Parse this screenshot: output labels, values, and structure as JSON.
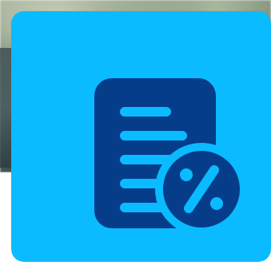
{
  "tile": {
    "icon": "tax-document-percent-icon",
    "colors": {
      "card_background": "#0abbff",
      "icon_foreground": "#053d8a",
      "page_background": "#ffffff"
    }
  }
}
